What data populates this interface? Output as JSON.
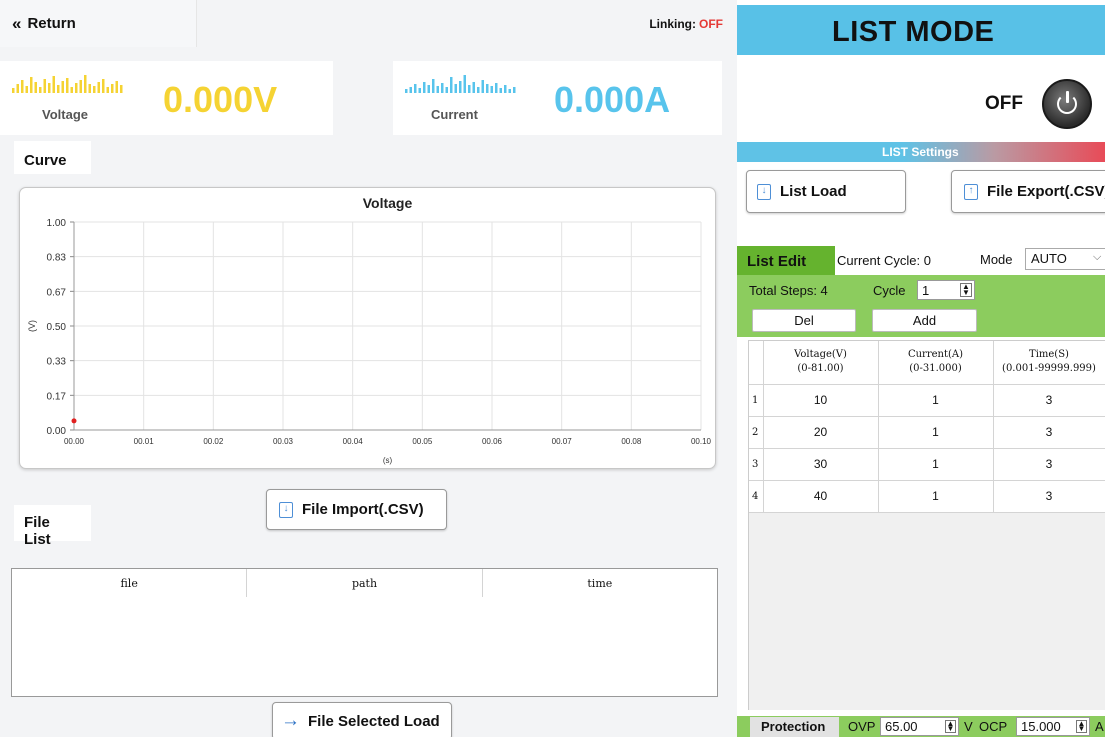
{
  "header": {
    "return_label": "Return",
    "linking_label": "Linking:",
    "linking_status": "OFF"
  },
  "meters": {
    "voltage_label": "Voltage",
    "voltage_value": "0.000V",
    "current_label": "Current",
    "current_value": "0.000A",
    "voltage_color": "#f5d333",
    "current_color": "#58c4ec"
  },
  "curve": {
    "tab_label": "Curve"
  },
  "chart_data": {
    "type": "line",
    "title": "Voltage",
    "xlabel": "(s)",
    "ylabel": "(V)",
    "xlim": [
      0,
      0.1
    ],
    "ylim": [
      0,
      1
    ],
    "x_ticks": [
      "00.00",
      "00.01",
      "00.02",
      "00.03",
      "00.04",
      "00.05",
      "00.06",
      "00.07",
      "00.08",
      "00.10"
    ],
    "y_ticks": [
      "1.00",
      "0.83",
      "0.67",
      "0.50",
      "0.33",
      "0.17",
      "0.00"
    ],
    "grid": true,
    "series": [
      {
        "points": [
          [
            0,
            0.02
          ]
        ],
        "color": "#e02020"
      }
    ]
  },
  "files": {
    "import_label": "File Import(.CSV)",
    "tab_label": "File List",
    "columns": [
      "file",
      "path",
      "time"
    ],
    "rows": [],
    "selected_load_label": "File  Selected Load"
  },
  "list_mode": {
    "title": "LIST MODE",
    "state": "OFF",
    "settings_label": "LIST Settings",
    "load_label": "List Load",
    "export_label": "File Export(.CSV)",
    "edit_label": "List Edit",
    "current_cycle_text": "Current Cycle: 0",
    "mode_label": "Mode",
    "mode_value": "AUTO",
    "total_steps_text": "Total Steps: 4",
    "cycle_label": "Cycle",
    "cycle_value": "1",
    "del_label": "Del",
    "add_label": "Add",
    "table_headers": [
      {
        "line1": "Voltage(V)",
        "line2": "(0-81.00)"
      },
      {
        "line1": "Current(A)",
        "line2": "(0-31.000)"
      },
      {
        "line1": "Time(S)",
        "line2": "(0.001-99999.999)"
      }
    ],
    "steps": [
      {
        "index": "1",
        "voltage": "10",
        "current": "1",
        "time": "3"
      },
      {
        "index": "2",
        "voltage": "20",
        "current": "1",
        "time": "3"
      },
      {
        "index": "3",
        "voltage": "30",
        "current": "1",
        "time": "3"
      },
      {
        "index": "4",
        "voltage": "40",
        "current": "1",
        "time": "3"
      }
    ],
    "protection_label": "Protection",
    "ovp_label": "OVP",
    "ovp_value": "65.00",
    "v_unit": "V",
    "ocp_label": "OCP",
    "ocp_value": "15.000",
    "a_unit": "A"
  }
}
